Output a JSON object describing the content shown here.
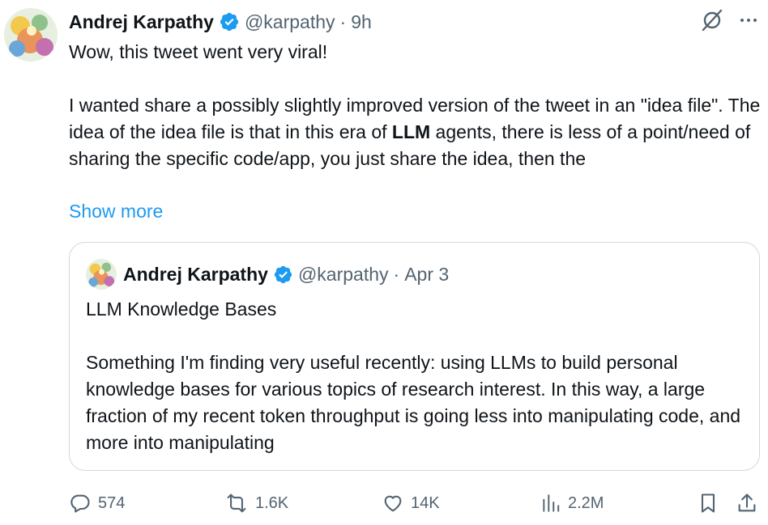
{
  "tweet": {
    "author_name": "Andrej Karpathy",
    "handle": "@karpathy",
    "separator": "·",
    "time": "9h",
    "text_line1": "Wow, this tweet went very viral!",
    "text_p2_before": "I wanted share a possibly slightly improved version of the tweet in an \"idea file\". The idea of the idea file is that in this era of ",
    "text_p2_bold": "LLM",
    "text_p2_after": " agents, there is less of a point/need of sharing the specific code/app, you just share the idea, then the",
    "show_more": "Show more"
  },
  "quote": {
    "author_name": "Andrej Karpathy",
    "handle": "@karpathy",
    "separator": "·",
    "time": "Apr 3",
    "title": "LLM Knowledge Bases",
    "body": "Something I'm finding very useful recently: using LLMs to build personal knowledge bases for various topics of research interest. In this way, a large fraction of my recent token throughput is going less into manipulating code, and more into manipulating"
  },
  "actions": {
    "replies": "574",
    "reposts": "1.6K",
    "likes": "14K",
    "views": "2.2M"
  },
  "colors": {
    "accent": "#1d9bf0",
    "muted": "#536471",
    "text": "#0f1419",
    "border": "#cfd9de"
  },
  "icons": [
    "grok-icon",
    "more-icon",
    "verified-icon",
    "reply-icon",
    "repost-icon",
    "like-icon",
    "views-icon",
    "bookmark-icon",
    "share-icon"
  ]
}
